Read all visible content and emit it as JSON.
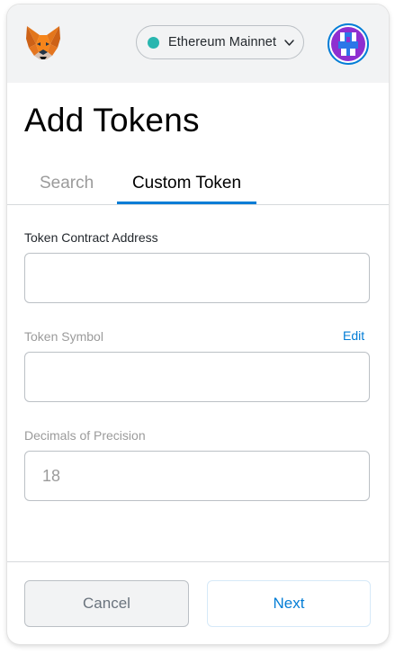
{
  "header": {
    "logo_icon": "metamask-fox-icon",
    "network": {
      "label": "Ethereum Mainnet",
      "dot_color": "#29b6af",
      "chevron_icon": "chevron-down-icon"
    },
    "account_icon": "account-identicon"
  },
  "page": {
    "title": "Add Tokens"
  },
  "tabs": [
    {
      "label": "Search",
      "active": false
    },
    {
      "label": "Custom Token",
      "active": true
    }
  ],
  "form": {
    "contract_address": {
      "label": "Token Contract Address",
      "value": "",
      "placeholder": ""
    },
    "token_symbol": {
      "label": "Token Symbol",
      "edit_label": "Edit",
      "value": "",
      "placeholder": ""
    },
    "decimals": {
      "label": "Decimals of Precision",
      "value": "",
      "placeholder": "18"
    }
  },
  "footer": {
    "cancel_label": "Cancel",
    "next_label": "Next"
  },
  "colors": {
    "accent": "#037dd6",
    "header_bg": "#f2f3f4",
    "network_dot": "#29b6af"
  }
}
